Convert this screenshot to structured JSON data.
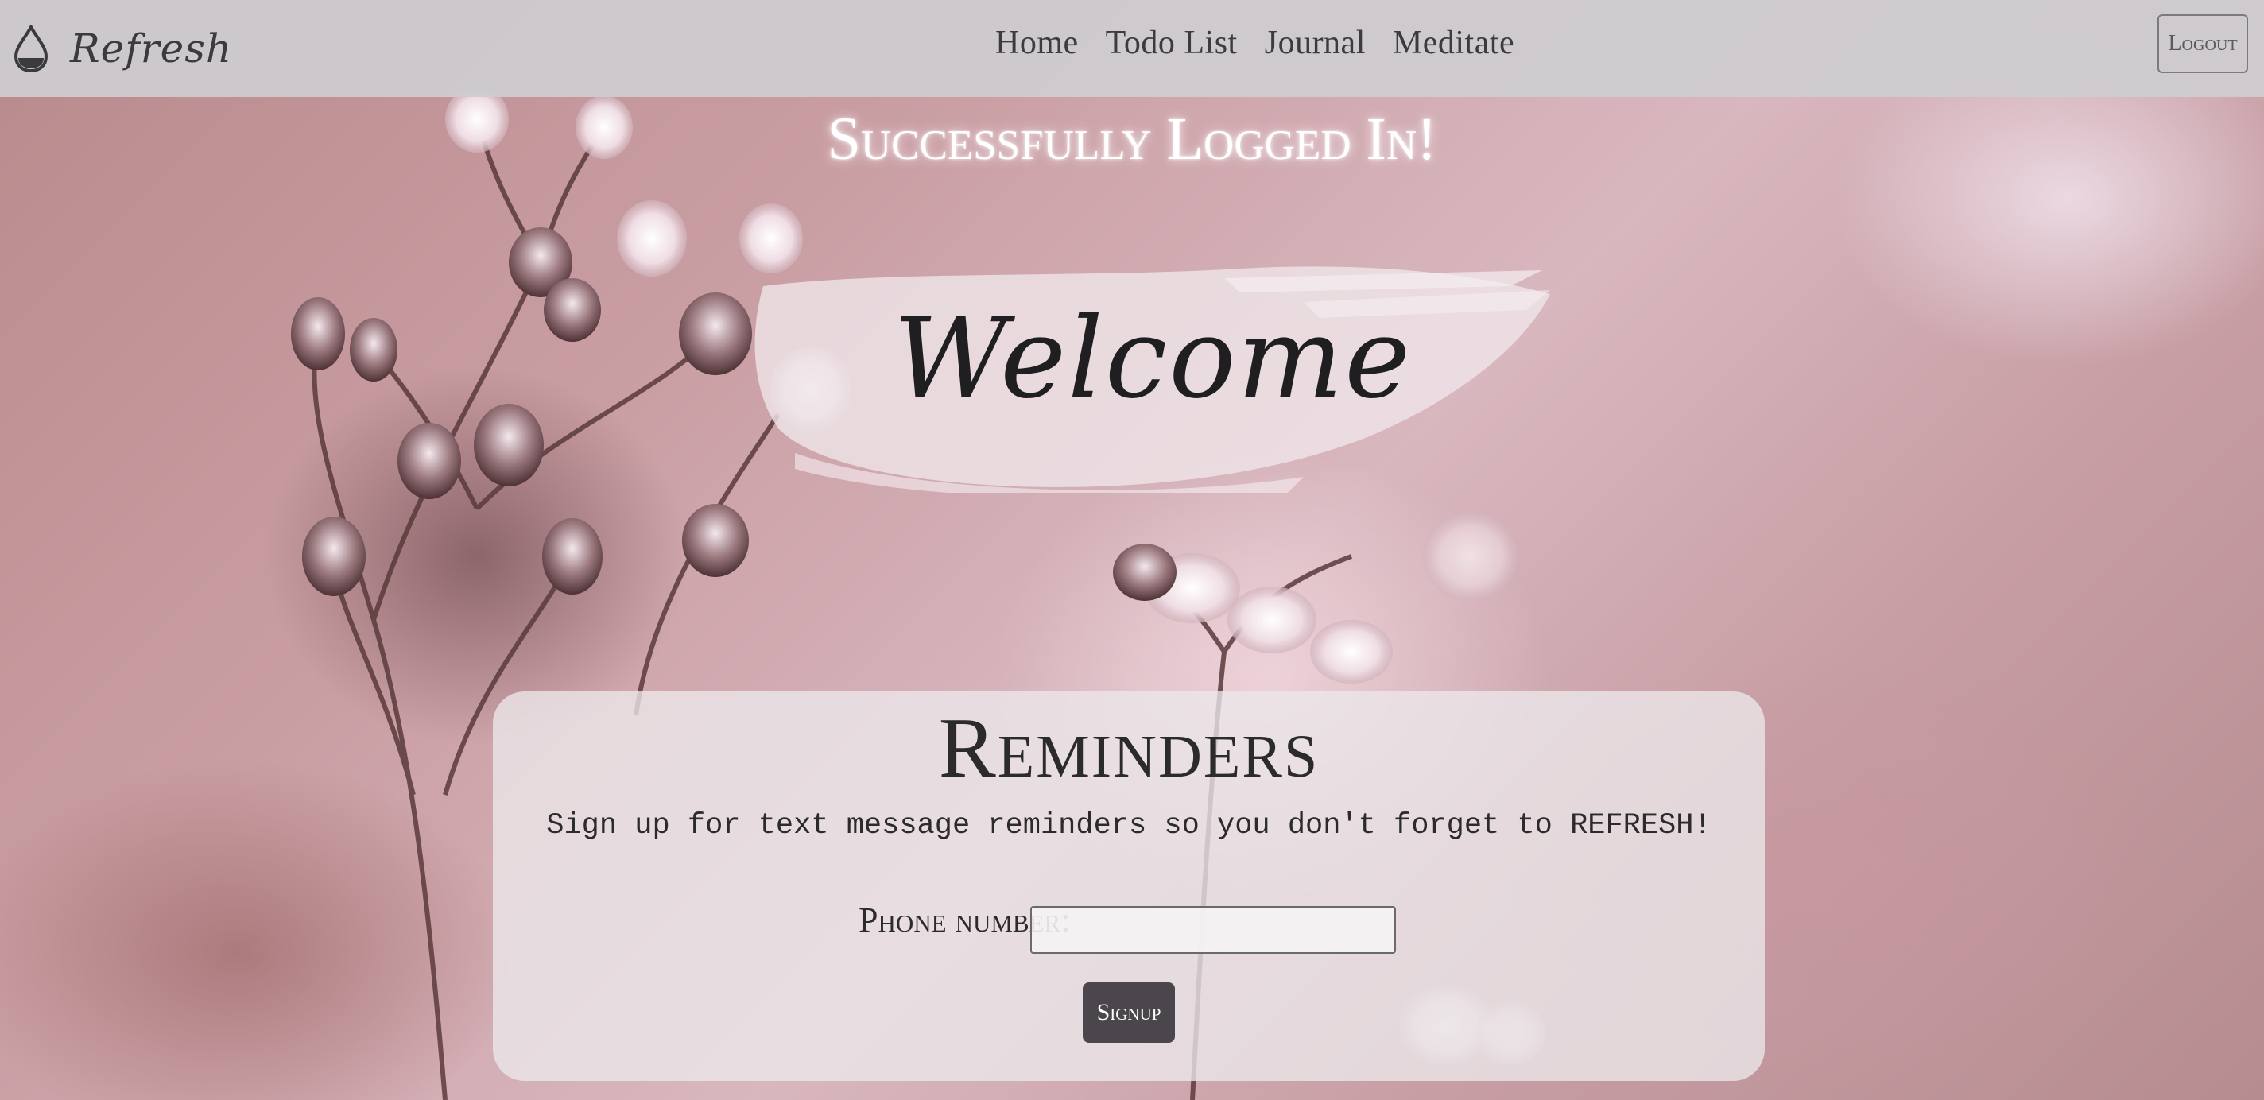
{
  "navbar": {
    "brand": "Refresh",
    "brand_icon": "water-drop-icon",
    "links": [
      "Home",
      "Todo List",
      "Journal",
      "Meditate"
    ],
    "logout_label": "Logout"
  },
  "main": {
    "success_message": "Successfully Logged In!",
    "welcome": "Welcome"
  },
  "reminders": {
    "title": "Reminders",
    "description": "Sign up for text message reminders so you don't forget to REFRESH!",
    "phone_label": "Phone number:",
    "phone_value": "",
    "signup_label": "Signup"
  },
  "colors": {
    "navbar_bg": "#cdccd0",
    "text_dark": "#2b2b2e",
    "button_bg": "#4a464b"
  }
}
